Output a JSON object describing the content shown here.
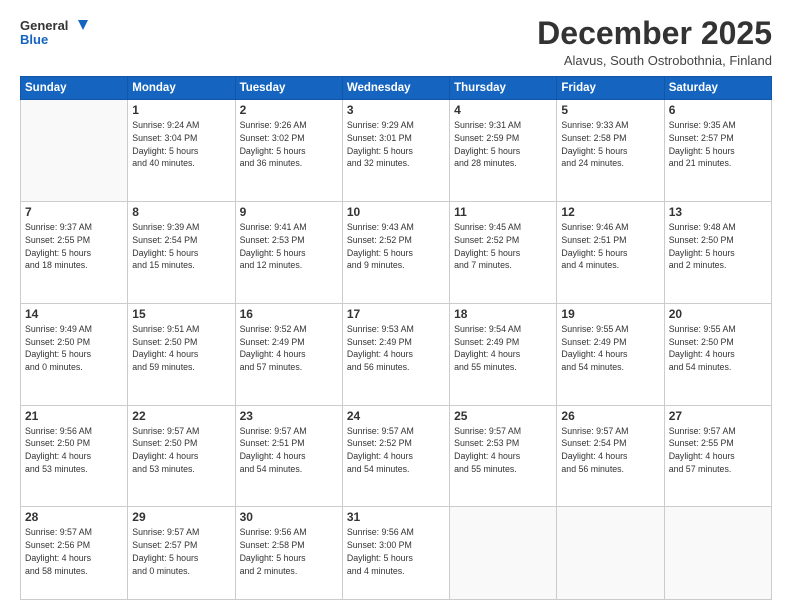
{
  "header": {
    "logo_general": "General",
    "logo_blue": "Blue",
    "month_title": "December 2025",
    "subtitle": "Alavus, South Ostrobothnia, Finland"
  },
  "weekdays": [
    "Sunday",
    "Monday",
    "Tuesday",
    "Wednesday",
    "Thursday",
    "Friday",
    "Saturday"
  ],
  "weeks": [
    [
      {
        "day": "",
        "info": ""
      },
      {
        "day": "1",
        "info": "Sunrise: 9:24 AM\nSunset: 3:04 PM\nDaylight: 5 hours\nand 40 minutes."
      },
      {
        "day": "2",
        "info": "Sunrise: 9:26 AM\nSunset: 3:02 PM\nDaylight: 5 hours\nand 36 minutes."
      },
      {
        "day": "3",
        "info": "Sunrise: 9:29 AM\nSunset: 3:01 PM\nDaylight: 5 hours\nand 32 minutes."
      },
      {
        "day": "4",
        "info": "Sunrise: 9:31 AM\nSunset: 2:59 PM\nDaylight: 5 hours\nand 28 minutes."
      },
      {
        "day": "5",
        "info": "Sunrise: 9:33 AM\nSunset: 2:58 PM\nDaylight: 5 hours\nand 24 minutes."
      },
      {
        "day": "6",
        "info": "Sunrise: 9:35 AM\nSunset: 2:57 PM\nDaylight: 5 hours\nand 21 minutes."
      }
    ],
    [
      {
        "day": "7",
        "info": "Sunrise: 9:37 AM\nSunset: 2:55 PM\nDaylight: 5 hours\nand 18 minutes."
      },
      {
        "day": "8",
        "info": "Sunrise: 9:39 AM\nSunset: 2:54 PM\nDaylight: 5 hours\nand 15 minutes."
      },
      {
        "day": "9",
        "info": "Sunrise: 9:41 AM\nSunset: 2:53 PM\nDaylight: 5 hours\nand 12 minutes."
      },
      {
        "day": "10",
        "info": "Sunrise: 9:43 AM\nSunset: 2:52 PM\nDaylight: 5 hours\nand 9 minutes."
      },
      {
        "day": "11",
        "info": "Sunrise: 9:45 AM\nSunset: 2:52 PM\nDaylight: 5 hours\nand 7 minutes."
      },
      {
        "day": "12",
        "info": "Sunrise: 9:46 AM\nSunset: 2:51 PM\nDaylight: 5 hours\nand 4 minutes."
      },
      {
        "day": "13",
        "info": "Sunrise: 9:48 AM\nSunset: 2:50 PM\nDaylight: 5 hours\nand 2 minutes."
      }
    ],
    [
      {
        "day": "14",
        "info": "Sunrise: 9:49 AM\nSunset: 2:50 PM\nDaylight: 5 hours\nand 0 minutes."
      },
      {
        "day": "15",
        "info": "Sunrise: 9:51 AM\nSunset: 2:50 PM\nDaylight: 4 hours\nand 59 minutes."
      },
      {
        "day": "16",
        "info": "Sunrise: 9:52 AM\nSunset: 2:49 PM\nDaylight: 4 hours\nand 57 minutes."
      },
      {
        "day": "17",
        "info": "Sunrise: 9:53 AM\nSunset: 2:49 PM\nDaylight: 4 hours\nand 56 minutes."
      },
      {
        "day": "18",
        "info": "Sunrise: 9:54 AM\nSunset: 2:49 PM\nDaylight: 4 hours\nand 55 minutes."
      },
      {
        "day": "19",
        "info": "Sunrise: 9:55 AM\nSunset: 2:49 PM\nDaylight: 4 hours\nand 54 minutes."
      },
      {
        "day": "20",
        "info": "Sunrise: 9:55 AM\nSunset: 2:50 PM\nDaylight: 4 hours\nand 54 minutes."
      }
    ],
    [
      {
        "day": "21",
        "info": "Sunrise: 9:56 AM\nSunset: 2:50 PM\nDaylight: 4 hours\nand 53 minutes."
      },
      {
        "day": "22",
        "info": "Sunrise: 9:57 AM\nSunset: 2:50 PM\nDaylight: 4 hours\nand 53 minutes."
      },
      {
        "day": "23",
        "info": "Sunrise: 9:57 AM\nSunset: 2:51 PM\nDaylight: 4 hours\nand 54 minutes."
      },
      {
        "day": "24",
        "info": "Sunrise: 9:57 AM\nSunset: 2:52 PM\nDaylight: 4 hours\nand 54 minutes."
      },
      {
        "day": "25",
        "info": "Sunrise: 9:57 AM\nSunset: 2:53 PM\nDaylight: 4 hours\nand 55 minutes."
      },
      {
        "day": "26",
        "info": "Sunrise: 9:57 AM\nSunset: 2:54 PM\nDaylight: 4 hours\nand 56 minutes."
      },
      {
        "day": "27",
        "info": "Sunrise: 9:57 AM\nSunset: 2:55 PM\nDaylight: 4 hours\nand 57 minutes."
      }
    ],
    [
      {
        "day": "28",
        "info": "Sunrise: 9:57 AM\nSunset: 2:56 PM\nDaylight: 4 hours\nand 58 minutes."
      },
      {
        "day": "29",
        "info": "Sunrise: 9:57 AM\nSunset: 2:57 PM\nDaylight: 5 hours\nand 0 minutes."
      },
      {
        "day": "30",
        "info": "Sunrise: 9:56 AM\nSunset: 2:58 PM\nDaylight: 5 hours\nand 2 minutes."
      },
      {
        "day": "31",
        "info": "Sunrise: 9:56 AM\nSunset: 3:00 PM\nDaylight: 5 hours\nand 4 minutes."
      },
      {
        "day": "",
        "info": ""
      },
      {
        "day": "",
        "info": ""
      },
      {
        "day": "",
        "info": ""
      }
    ]
  ]
}
